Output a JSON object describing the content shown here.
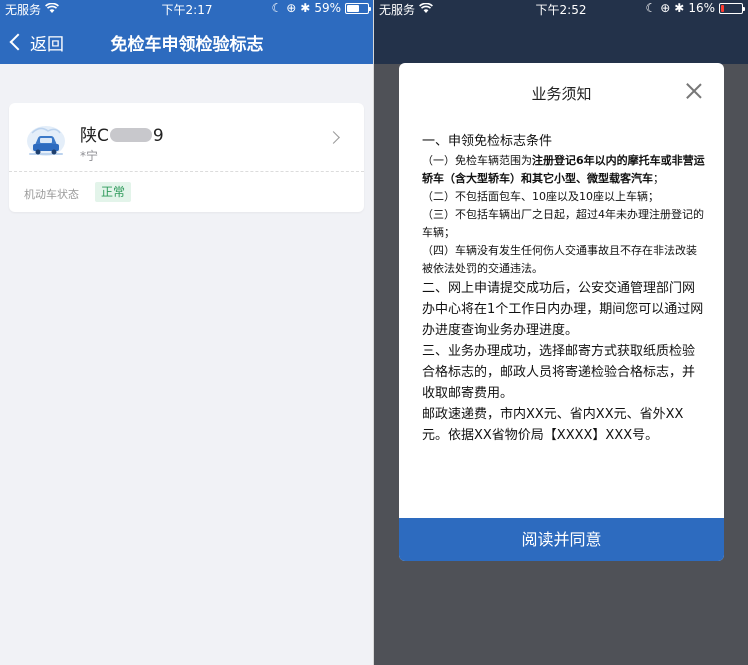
{
  "left": {
    "status": {
      "carrier": "无服务",
      "time": "下午2:17",
      "battery": "59%",
      "battery_level": 0.59
    },
    "nav": {
      "back_label": "返回",
      "title": "免检车申领检验标志"
    },
    "vehicle": {
      "plate_prefix": "陕C",
      "plate_suffix": "9",
      "owner": "*宁",
      "status_label": "机动车状态",
      "status_value": "正常"
    }
  },
  "right": {
    "status": {
      "carrier": "无服务",
      "time": "下午2:52",
      "battery": "16%",
      "battery_level": 0.16
    },
    "nav": {
      "title": ""
    },
    "modal": {
      "title": "业务须知",
      "lines": [
        {
          "size": "lg",
          "text": "一、申领免检标志条件"
        },
        {
          "size": "sm",
          "pre": "（一）免检车辆范围为",
          "bold": "注册登记6年以内的摩托车或非营运轿车（含大型轿车）和其它小型、微型载客汽车",
          "post": "；"
        },
        {
          "size": "sm",
          "text": "（二）不包括面包车、10座以及10座以上车辆；"
        },
        {
          "size": "sm",
          "text": "（三）不包括车辆出厂之日起，超过4年未办理注册登记的车辆；"
        },
        {
          "size": "sm",
          "text": "（四）车辆没有发生任何伤人交通事故且不存在非法改装被依法处罚的交通违法。"
        },
        {
          "size": "lg",
          "text": "二、网上申请提交成功后，公安交通管理部门网办中心将在1个工作日内办理，期间您可以通过网办进度查询业务办理进度。"
        },
        {
          "size": "lg",
          "text": "三、业务办理成功，选择邮寄方式获取纸质检验合格标志的，邮政人员将寄递检验合格标志，并收取邮寄费用。"
        },
        {
          "size": "lg",
          "text": "邮政速递费，市内XX元、省内XX元、省外XX元。依据XX省物价局【XXXX】XXX号。"
        }
      ],
      "agree_label": "阅读并同意"
    }
  },
  "colors": {
    "header_blue": "#2d6bbf",
    "badge_green": "#2e9a5b",
    "badge_bg": "#e3f4ea"
  }
}
